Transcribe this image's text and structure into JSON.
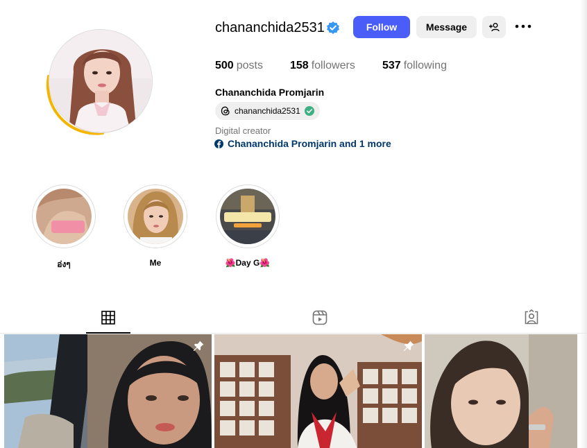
{
  "profile": {
    "username": "chananchida2531",
    "verified": true,
    "full_name": "Chananchida Promjarin",
    "threads_handle": "chananchida2531",
    "category": "Digital creator",
    "link_text": "Chananchida Promjarin and 1 more"
  },
  "actions": {
    "follow_label": "Follow",
    "message_label": "Message"
  },
  "stats": [
    {
      "value": "500",
      "label": "posts"
    },
    {
      "value": "158",
      "label": "followers"
    },
    {
      "value": "537",
      "label": "following"
    }
  ],
  "highlights": [
    {
      "label": "อ่งๆ",
      "overlay_text": "หนูชอบงานบริการมาก ขอบคุณที่ไว้ใจ"
    },
    {
      "label": "Me"
    },
    {
      "label": "🌺Day G🌺",
      "overlay_text": "ประเมินความพึงพอใจ"
    }
  ],
  "tabs": [
    {
      "name": "posts",
      "icon": "grid-icon",
      "active": true
    },
    {
      "name": "reels",
      "icon": "reels-icon",
      "active": false
    },
    {
      "name": "tagged",
      "icon": "tagged-icon",
      "active": false
    }
  ],
  "posts": [
    {
      "pinned": true
    },
    {
      "pinned": true
    },
    {
      "pinned": false
    }
  ],
  "colors": {
    "follow": "#4a5df9",
    "verified": "#3897f0",
    "link": "#00376b",
    "story_ring": "#f5b400",
    "threads_check": "#3fb084"
  }
}
